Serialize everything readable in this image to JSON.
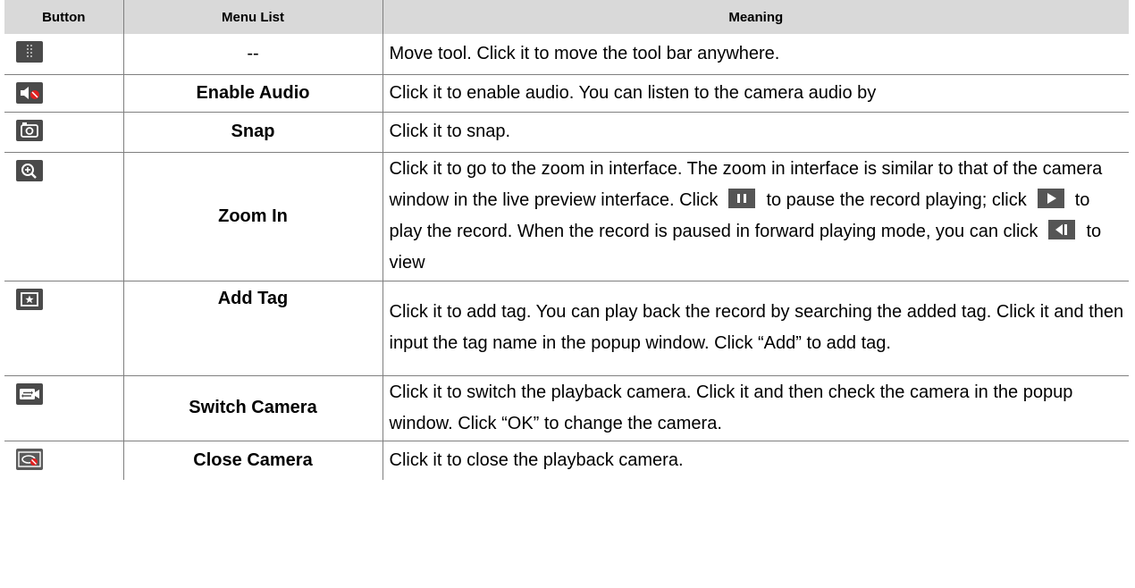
{
  "headers": {
    "button": "Button",
    "menu": "Menu List",
    "meaning": "Meaning"
  },
  "rows": [
    {
      "icon": "move-handle-icon",
      "menu": "--",
      "meaning": "Move tool. Click it to move the tool bar anywhere."
    },
    {
      "icon": "audio-muted-icon",
      "menu": "Enable Audio",
      "meaning": "Click it to enable audio. You can listen to the camera audio by"
    },
    {
      "icon": "camera-snap-icon",
      "menu": "Snap",
      "meaning": "Click it to snap."
    },
    {
      "icon": "zoom-in-icon",
      "menu": "Zoom In",
      "meaning_parts": [
        "Click it to go to the zoom in interface. The zoom in interface is similar to that of the camera window in the live preview interface. Click",
        "to pause the record playing; click",
        "to play the record. When the record is paused in forward playing mode, you can click",
        "to view"
      ],
      "inline_icons": [
        "pause-icon",
        "play-icon",
        "step-back-icon"
      ]
    },
    {
      "icon": "tag-star-icon",
      "menu": "Add Tag",
      "meaning": "Click it to add tag. You can play back the record by searching the added tag. Click it and then input the tag name in the popup window. Click “Add” to add tag."
    },
    {
      "icon": "switch-camera-icon",
      "menu": "Switch Camera",
      "meaning": "Click it to switch the playback camera. Click it and then check the camera in the popup window. Click “OK” to change the camera."
    },
    {
      "icon": "close-camera-icon",
      "menu": "Close Camera",
      "meaning": "Click it to close the playback camera."
    }
  ],
  "colors": {
    "header_bg": "#d9d9d9",
    "icon_bg": "#4a4a4a",
    "audio_muted_badge": "#e02020",
    "close_camera_badge": "#e02020",
    "border": "#7f7f7f"
  }
}
